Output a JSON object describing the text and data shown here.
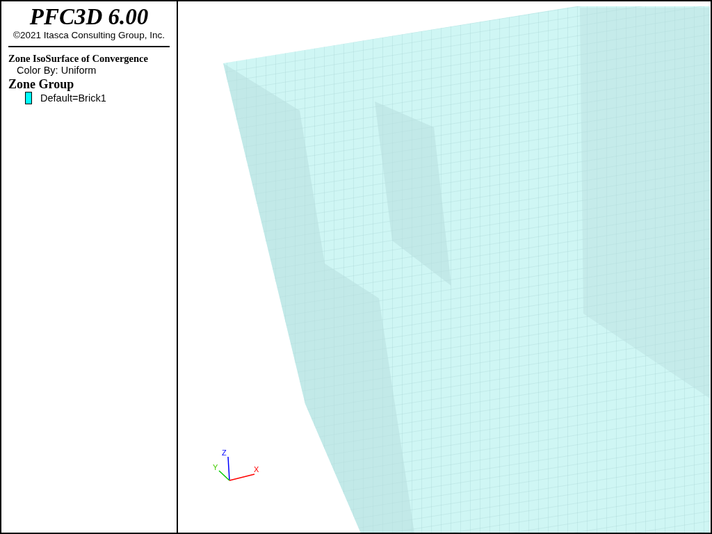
{
  "title": "PFC3D 6.00",
  "copyright": "©2021 Itasca Consulting Group, Inc.",
  "legend": {
    "plot_item": "Zone IsoSurface of Convergence",
    "color_by": "Color By: Uniform",
    "group_title": "Zone Group",
    "items": [
      {
        "label": "Default=Brick1",
        "color": "#00ffff"
      }
    ]
  },
  "axes": {
    "x": "X",
    "y": "Y",
    "z": "Z"
  }
}
